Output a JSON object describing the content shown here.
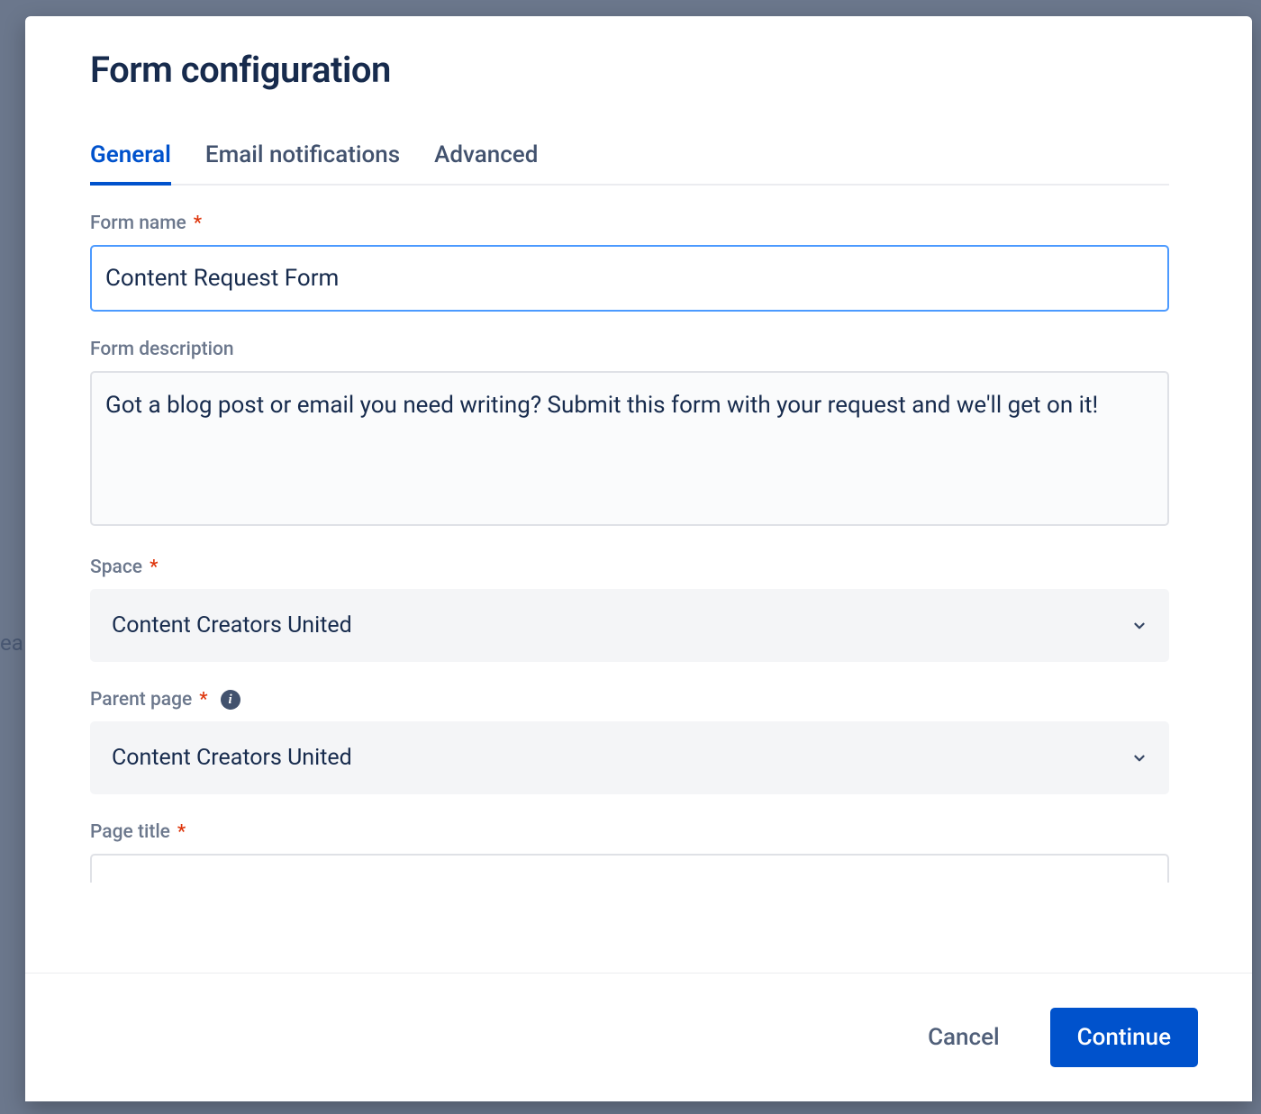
{
  "modal": {
    "title": "Form configuration"
  },
  "tabs": {
    "general": "General",
    "email": "Email notifications",
    "advanced": "Advanced"
  },
  "fields": {
    "form_name": {
      "label": "Form name",
      "value": "Content Request Form"
    },
    "form_description": {
      "label": "Form description",
      "value": "Got a blog post or email you need writing? Submit this form with your request and we'll get on it!"
    },
    "space": {
      "label": "Space",
      "value": "Content Creators United"
    },
    "parent_page": {
      "label": "Parent page",
      "value": "Content Creators United"
    },
    "page_title": {
      "label": "Page title",
      "value": ""
    }
  },
  "footer": {
    "cancel": "Cancel",
    "continue": "Continue"
  },
  "required_marker": "*",
  "background_hint": "ea"
}
